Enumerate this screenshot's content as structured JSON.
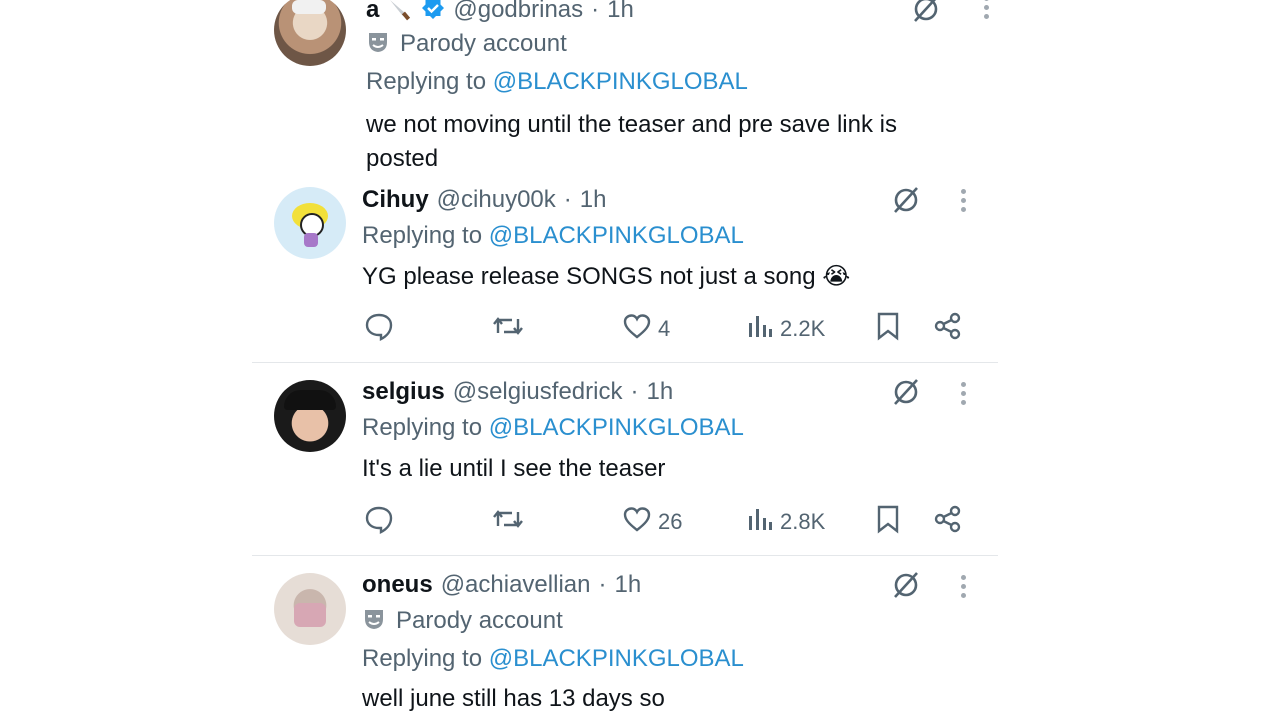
{
  "tweets": [
    {
      "name": "a",
      "handle": "@godbrinas",
      "time": "1h",
      "parody": "Parody account",
      "replying_prefix": "Replying to",
      "replying_to": "@BLACKPINKGLOBAL",
      "text": "we not moving until the teaser and pre save link is posted"
    },
    {
      "name": "Cihuy",
      "handle": "@cihuy00k",
      "time": "1h",
      "replying_prefix": "Replying to",
      "replying_to": "@BLACKPINKGLOBAL",
      "text": "YG please release SONGS not just a song 😭",
      "likes": "4",
      "views": "2.2K"
    },
    {
      "name": "selgius",
      "handle": "@selgiusfedrick",
      "time": "1h",
      "replying_prefix": "Replying to",
      "replying_to": "@BLACKPINKGLOBAL",
      "text": "It's a lie until I see the teaser",
      "likes": "26",
      "views": "2.8K"
    },
    {
      "name": "oneus",
      "handle": "@achiavellian",
      "time": "1h",
      "parody": "Parody account",
      "replying_prefix": "Replying to",
      "replying_to": "@BLACKPINKGLOBAL",
      "text": "well june still has 13 days so"
    }
  ],
  "separator": "·",
  "icons": {
    "grok": "grok-slash-icon",
    "more": "more-options-icon",
    "reply": "reply-bubble-icon",
    "retweet": "retweet-icon",
    "like": "heart-icon",
    "views": "views-bar-icon",
    "bookmark": "bookmark-icon",
    "share": "share-icon",
    "verified": "verified-badge-icon",
    "parody": "parody-mask-icon"
  },
  "colors": {
    "mention": "#2a8fcf",
    "muted": "#536471",
    "verified": "#1d9bf0"
  }
}
